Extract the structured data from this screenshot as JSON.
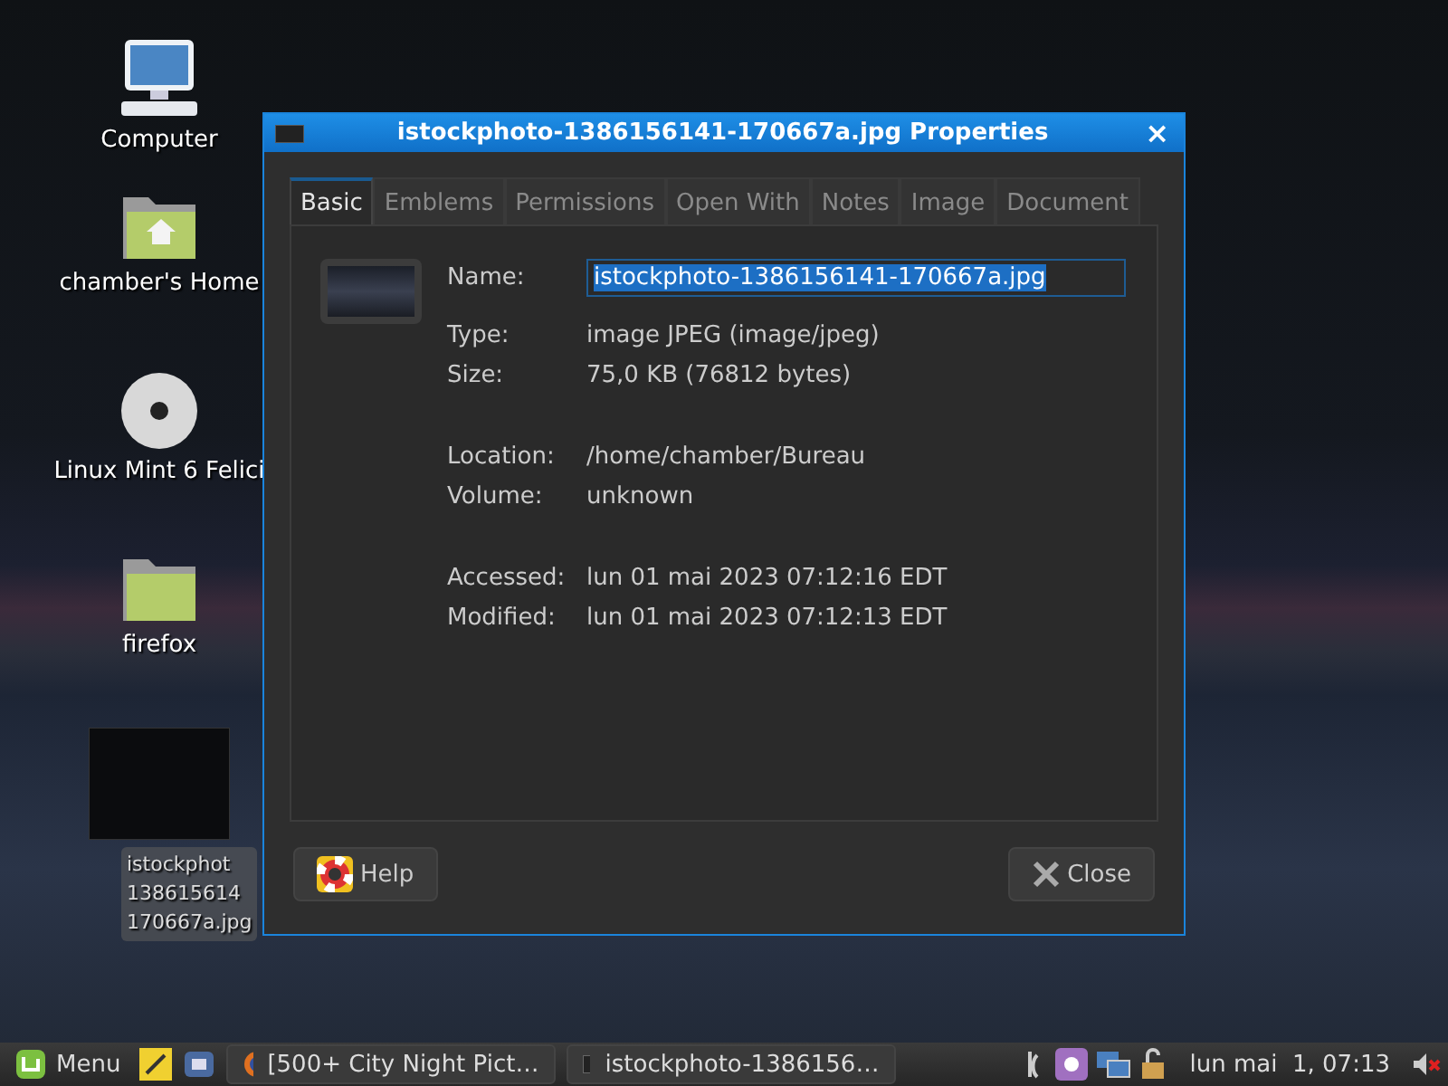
{
  "desktop_icons": [
    {
      "kind": "computer",
      "label": "Computer"
    },
    {
      "kind": "home",
      "label": "chamber's Home"
    },
    {
      "kind": "disc",
      "label": "Linux Mint 6 Felici"
    },
    {
      "kind": "folder",
      "label": "firefox"
    },
    {
      "kind": "image",
      "label": "istockphot\n138615614\n170667a.jpg"
    }
  ],
  "window": {
    "title": "istockphoto-1386156141-170667a.jpg Properties",
    "close": "×",
    "tabs": [
      {
        "label": "Basic",
        "selected": true
      },
      {
        "label": "Emblems",
        "selected": false
      },
      {
        "label": "Permissions",
        "selected": false
      },
      {
        "label": "Open With",
        "selected": false
      },
      {
        "label": "Notes",
        "selected": false
      },
      {
        "label": "Image",
        "selected": false
      },
      {
        "label": "Document",
        "selected": false
      }
    ],
    "name_field": {
      "label": "Name:",
      "value": "istockphoto-1386156141-170667a.jpg",
      "text_selected": true
    },
    "info_groups": [
      [
        {
          "label": "Type:",
          "value": "image JPEG (image/jpeg)"
        },
        {
          "label": "Size:",
          "value": "75,0 KB (76812 bytes)"
        }
      ],
      [
        {
          "label": "Location:",
          "value": "/home/chamber/Bureau"
        },
        {
          "label": "Volume:",
          "value": "unknown"
        }
      ],
      [
        {
          "label": "Accessed:",
          "value": "lun 01 mai 2023 07:12:16 EDT"
        },
        {
          "label": "Modified:",
          "value": "lun 01 mai 2023 07:12:13 EDT"
        }
      ]
    ],
    "buttons": [
      {
        "kind": "help",
        "label": "Help"
      },
      {
        "kind": "close",
        "label": "Close"
      }
    ]
  },
  "taskbar": {
    "menu_label": "Menu",
    "launchers": [
      {
        "kind": "notes"
      },
      {
        "kind": "screen"
      }
    ],
    "tasks": [
      {
        "kind": "browser",
        "label": "[500+ City Night Pict…"
      },
      {
        "kind": "window",
        "label": "istockphoto-1386156…"
      }
    ],
    "clock": "lun mai  1, 07:13"
  }
}
